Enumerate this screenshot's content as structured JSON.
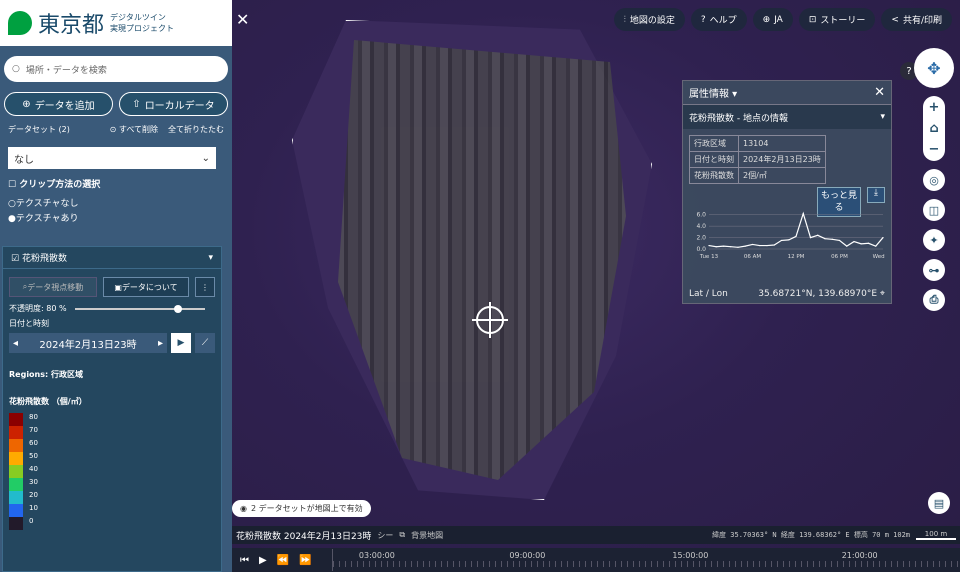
{
  "logo": {
    "title": "東京都",
    "subtitle_line1": "デジタルツイン",
    "subtitle_line2": "実現プロジェクト"
  },
  "search": {
    "placeholder": "場所・データを検索"
  },
  "buttons": {
    "add_data": "データを追加",
    "local_data": "ローカルデータ"
  },
  "datasets": {
    "label": "データセット (2)",
    "delete_all": "すべて削除",
    "collapse_all": "全て折りたたむ"
  },
  "select": {
    "value": "なし"
  },
  "clip": {
    "label": "クリップ方法の選択",
    "option1": "テクスチャなし",
    "option2": "テクスチャあり"
  },
  "layer": {
    "title": "花粉飛散数",
    "move_btn": "データ視点移動",
    "about_btn": "データについて",
    "opacity_label": "不透明度: 80 %",
    "opacity_value": 0.8,
    "datetime_label": "日付と時刻",
    "datetime_value": "2024年2月13日23時",
    "regions": "Regions: 行政区域",
    "legend_title": "花粉飛散数 （個/㎡）",
    "legend": [
      {
        "label": "80",
        "color": "#8b0000"
      },
      {
        "label": "70",
        "color": "#cc2200"
      },
      {
        "label": "60",
        "color": "#ee6600"
      },
      {
        "label": "50",
        "color": "#ffaa00"
      },
      {
        "label": "40",
        "color": "#88cc22"
      },
      {
        "label": "30",
        "color": "#22cc66"
      },
      {
        "label": "20",
        "color": "#22bbcc"
      },
      {
        "label": "10",
        "color": "#2266ee"
      },
      {
        "label": "0",
        "color": "#221a2a"
      }
    ]
  },
  "topbar": {
    "settings": "地図の設定",
    "help": "ヘルプ",
    "lang": "JA",
    "story": "ストーリー",
    "share": "共有/印刷"
  },
  "attr_panel": {
    "title": "属性情報",
    "subtitle": "花粉飛散数 - 地点の情報",
    "rows": [
      {
        "k": "行政区域",
        "v": "13104"
      },
      {
        "k": "日付と時刻",
        "v": "2024年2月13日23時"
      },
      {
        "k": "花粉飛散数",
        "v": "2個/㎡"
      }
    ],
    "more": "もっと見る",
    "latlon_label": "Lat / Lon",
    "latlon_value": "35.68721°N, 139.68970°E"
  },
  "chart_data": {
    "type": "line",
    "x": [
      "Tue 13",
      "",
      "",
      "",
      "",
      "",
      "06 AM",
      "",
      "",
      "",
      "",
      "",
      "12 PM",
      "",
      "",
      "",
      "",
      "",
      "06 PM",
      "",
      "",
      "",
      "",
      "",
      "Wed 14"
    ],
    "values": [
      0.6,
      0.4,
      0.5,
      0.4,
      0.3,
      0.5,
      0.8,
      0.6,
      0.6,
      0.7,
      1.5,
      1.6,
      2.2,
      6.2,
      2.0,
      2.4,
      1.8,
      1.7,
      1.5,
      0.5,
      1.3,
      0.9,
      1.0,
      0.5,
      2.0
    ],
    "x_tick_labels": [
      "Tue 13",
      "06 AM",
      "12 PM",
      "06 PM",
      "Wed 14"
    ],
    "y_ticks": [
      "0.0",
      "2.0",
      "4.0",
      "6.0"
    ],
    "ylim": [
      0,
      7
    ]
  },
  "map": {
    "ds_message": "2 データセットが地図上で有効",
    "status_title": "花粉飛散数 2024年2月13日23時",
    "status_links": "シー",
    "status_link2": "背景地図",
    "coords": "緯度 35.70363° N  経度 139.68362° E  標高 70 m 102m",
    "scale": "100 m"
  },
  "timeline": {
    "ticks": [
      "03:00:00",
      "09:00:00",
      "15:00:00",
      "21:00:00"
    ]
  }
}
